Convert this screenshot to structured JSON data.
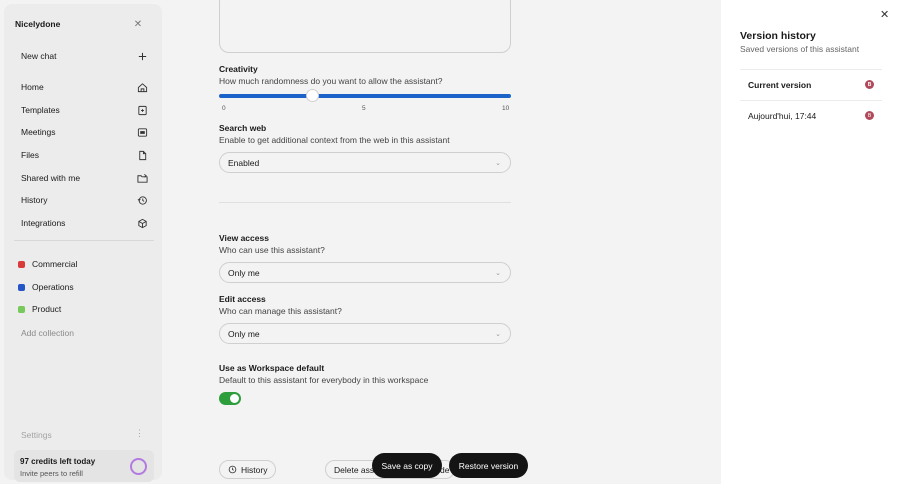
{
  "sidebar": {
    "brand": "Nicelydone",
    "items": [
      {
        "label": "New chat",
        "icon": "plus-icon"
      },
      {
        "label": "Home",
        "icon": "home-icon"
      },
      {
        "label": "Templates",
        "icon": "templates-icon"
      },
      {
        "label": "Meetings",
        "icon": "meetings-icon"
      },
      {
        "label": "Files",
        "icon": "file-icon"
      },
      {
        "label": "Shared with me",
        "icon": "shared-folder-icon"
      },
      {
        "label": "History",
        "icon": "history-icon"
      },
      {
        "label": "Integrations",
        "icon": "integrations-icon"
      }
    ],
    "collections": [
      {
        "label": "Commercial",
        "color": "#d93b3b"
      },
      {
        "label": "Operations",
        "color": "#2456c7"
      },
      {
        "label": "Product",
        "color": "#76c95a"
      }
    ],
    "add_collection": "Add collection",
    "settings": "Settings",
    "credits": {
      "title": "97 credits left today",
      "subtitle": "Invite peers to refill"
    }
  },
  "main": {
    "creativity": {
      "title": "Creativity",
      "subtitle": "How much randomness do you want to allow the assistant?",
      "value": 3.2,
      "min": 0,
      "max": 10,
      "ticks": [
        "0",
        "5",
        "10"
      ]
    },
    "search_web": {
      "title": "Search web",
      "subtitle": "Enable to get additional context from the web in this assistant",
      "value": "Enabled"
    },
    "view_access": {
      "title": "View access",
      "subtitle": "Who can use this assistant?",
      "value": "Only me"
    },
    "edit_access": {
      "title": "Edit access",
      "subtitle": "Who can manage this assistant?",
      "value": "Only me"
    },
    "workspace_default": {
      "title": "Use as Workspace default",
      "subtitle": "Default to this assistant for everybody in this workspace",
      "enabled": true
    },
    "buttons": {
      "history": "History",
      "delete": "Delete assi",
      "partial": "de",
      "save_copy": "Save as copy",
      "restore": "Restore version"
    }
  },
  "panel": {
    "title": "Version history",
    "subtitle": "Saved versions of this assistant",
    "versions": [
      {
        "label": "Current version",
        "badge": "B"
      },
      {
        "label": "Aujourd'hui, 17:44",
        "badge": "B"
      }
    ]
  },
  "colors": {
    "slider": "#1b63c9",
    "toggle_on": "#2e9d3c",
    "badge": "#b04a5b",
    "dark_button": "#141414"
  }
}
